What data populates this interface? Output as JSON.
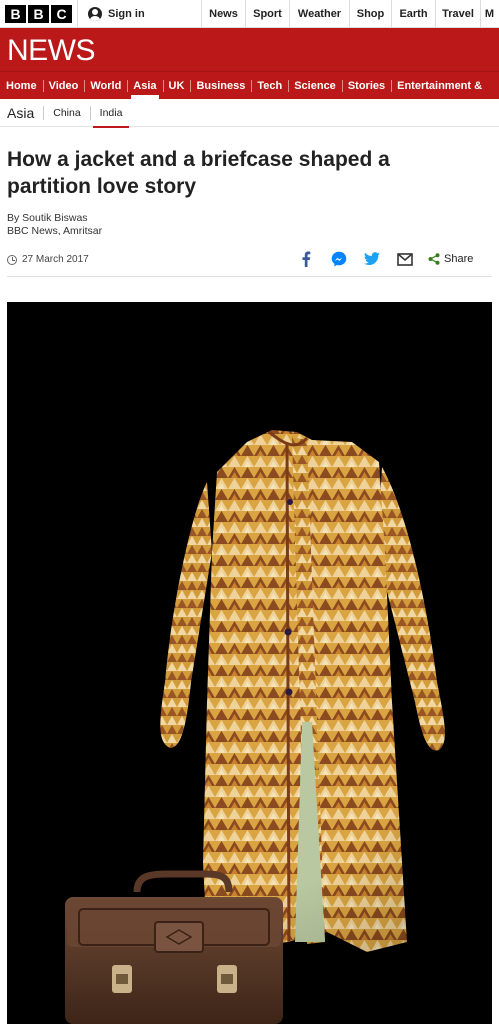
{
  "topbar": {
    "logo_letters": [
      "B",
      "B",
      "C"
    ],
    "signin_label": "Sign in",
    "links": [
      "News",
      "Sport",
      "Weather",
      "Shop",
      "Earth",
      "Travel",
      "M"
    ]
  },
  "brand": "NEWS",
  "nav": {
    "items": [
      "Home",
      "Video",
      "World",
      "Asia",
      "UK",
      "Business",
      "Tech",
      "Science",
      "Stories",
      "Entertainment &"
    ],
    "active": "Asia"
  },
  "subnav": {
    "section": "Asia",
    "links": [
      "China",
      "India"
    ],
    "active": "India"
  },
  "article": {
    "headline": "How a jacket and a briefcase shaped a partition love story",
    "author": "By Soutik Biswas",
    "location": "BBC News, Amritsar",
    "date": "27 March 2017",
    "share_label": "Share"
  },
  "share_icons": [
    "facebook-icon",
    "messenger-icon",
    "twitter-icon",
    "email-icon"
  ],
  "colors": {
    "bbc_red": "#bb1919",
    "facebook": "#3b5998",
    "messenger": "#0084ff",
    "twitter": "#1da1f2",
    "share_green": "#3a7d1c"
  }
}
